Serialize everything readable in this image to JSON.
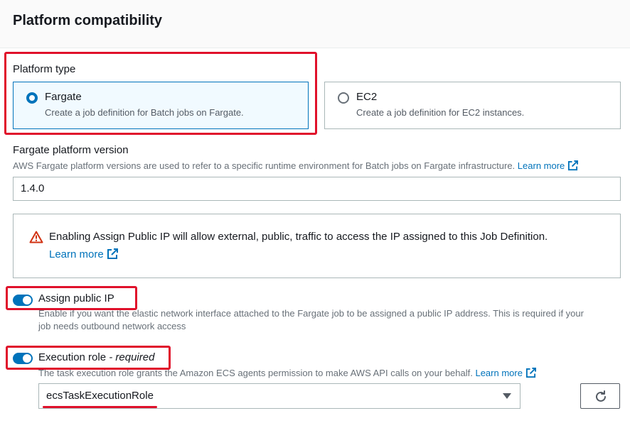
{
  "header": {
    "title": "Platform compatibility"
  },
  "platform_type": {
    "label": "Platform type",
    "options": [
      {
        "label": "Fargate",
        "description": "Create a job definition for Batch jobs on Fargate.",
        "selected": true
      },
      {
        "label": "EC2",
        "description": "Create a job definition for EC2 instances.",
        "selected": false
      }
    ]
  },
  "fargate_version": {
    "label": "Fargate platform version",
    "description": "AWS Fargate platform versions are used to refer to a specific runtime environment for Batch jobs on Fargate infrastructure.",
    "learn_more": "Learn more",
    "value": "1.4.0"
  },
  "alert": {
    "icon": "warning-icon",
    "message": "Enabling Assign Public IP will allow external, public, traffic to access the IP assigned to this Job Definition.",
    "learn_more": "Learn more"
  },
  "assign_public_ip": {
    "label": "Assign public IP",
    "enabled": true,
    "description_line1": "Enable if you want the elastic network interface attached to the Fargate job to be assigned a public IP address. This is required if your",
    "description_line2": "job needs outbound network access"
  },
  "execution_role": {
    "label": "Execution role",
    "required_suffix": " - required",
    "enabled": true,
    "description": "The task execution role grants the Amazon ECS agents permission to make AWS API calls on your behalf.",
    "learn_more": "Learn more",
    "selected_value": "ecsTaskExecutionRole"
  },
  "colors": {
    "accent": "#0073bb",
    "annotation": "#e0112b",
    "text": "#16191f",
    "secondary_text": "#687078"
  }
}
